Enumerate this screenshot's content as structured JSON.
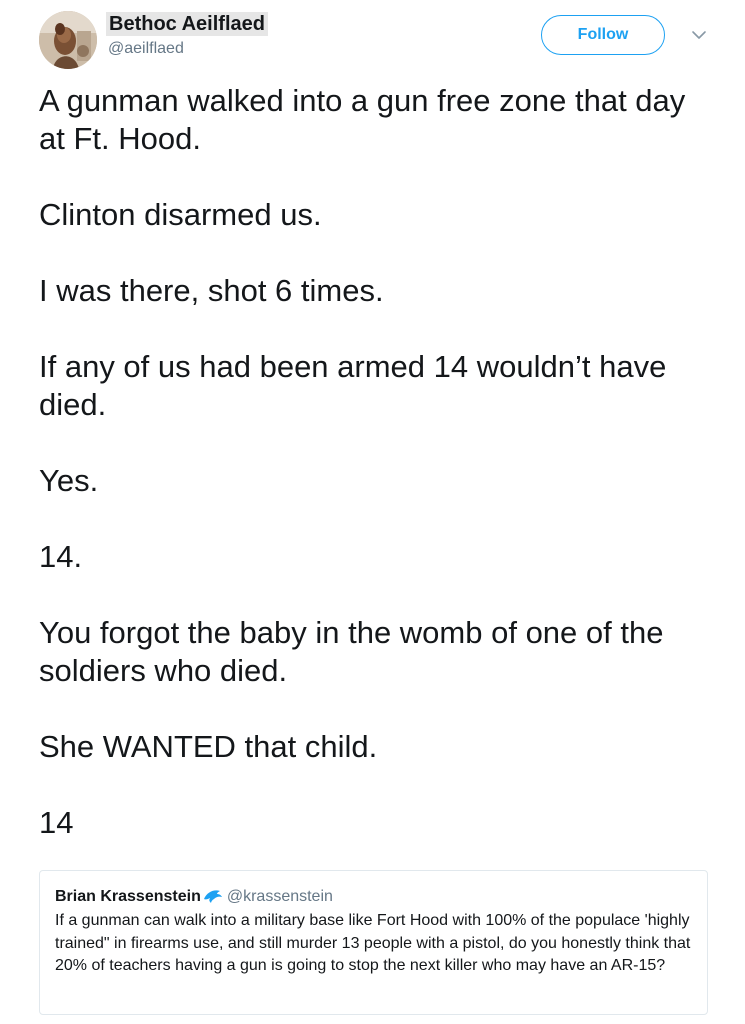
{
  "author": {
    "display_name": "Bethoc Aeilflaed",
    "handle": "@aeilflaed",
    "avatar_icon": "avatar-photo"
  },
  "actions": {
    "follow_label": "Follow",
    "menu_icon": "chevron-down-icon"
  },
  "colors": {
    "accent": "#1da1f2",
    "text": "#14171a",
    "muted": "#657786",
    "border": "#e1e8ed"
  },
  "tweet": {
    "paragraphs": [
      "A gunman walked into a gun free zone that day at Ft. Hood.",
      "Clinton disarmed us.",
      "I was there, shot 6 times.",
      "If any of us had been armed 14 wouldn’t have died.",
      "Yes.",
      "14.",
      "You forgot the baby in the womb of one of the soldiers who died.",
      "She WANTED that child.",
      "14"
    ]
  },
  "quoted_tweet": {
    "display_name": "Brian Krassenstein",
    "handle": "@krassenstein",
    "badge_icon": "dolphin-icon",
    "text": "If a gunman can walk into a military base like Fort Hood with 100% of the populace 'highly trained\" in firearms use, and still murder 13 people with a pistol, do you honestly think that 20% of teachers having a gun is going to stop the next killer who may have an AR-15?"
  }
}
